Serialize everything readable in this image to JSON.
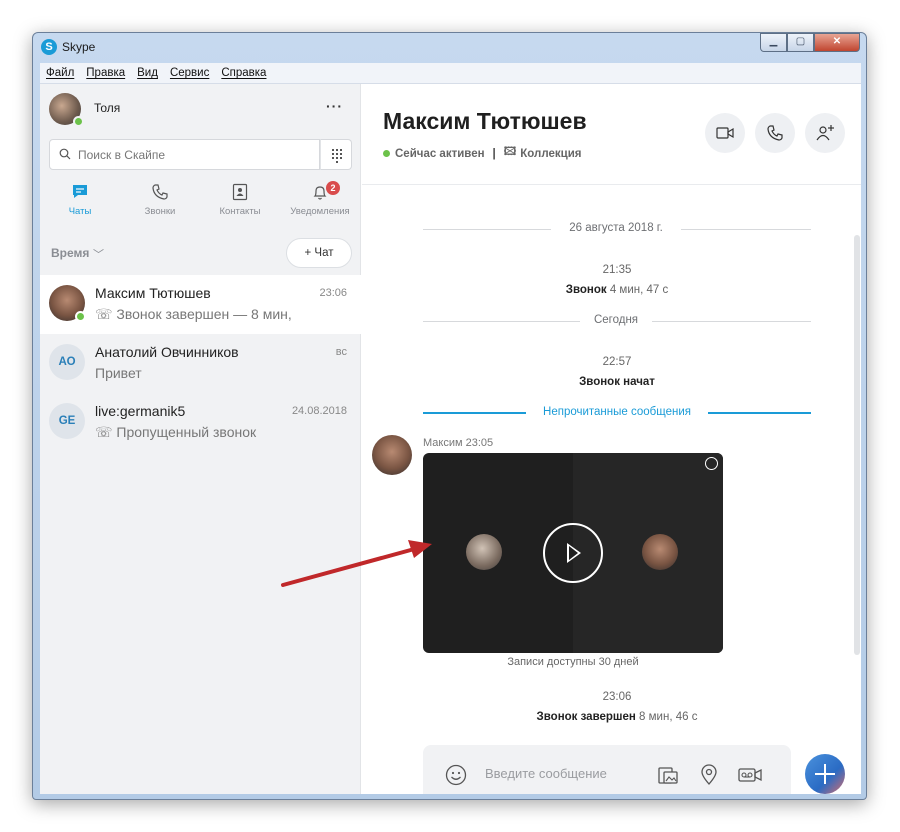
{
  "window": {
    "title": "Skype"
  },
  "menu": [
    "Файл",
    "Правка",
    "Вид",
    "Сервис",
    "Справка"
  ],
  "profile": {
    "name": "Толя"
  },
  "search": {
    "placeholder": "Поиск в Скайпе"
  },
  "nav": {
    "chats": "Чаты",
    "calls": "Звонки",
    "contacts": "Контакты",
    "notifications": "Уведомления",
    "notifications_badge": "2"
  },
  "sort": {
    "label": "Время",
    "new_chat": "+ Чат"
  },
  "chats": [
    {
      "name": "Максим Тютюшев",
      "time": "23:06",
      "preview": "Звонок завершен — 8 мин,",
      "preview_icon": "call-end-icon"
    },
    {
      "initials": "АО",
      "name": "Анатолий Овчинников",
      "time": "вс",
      "preview": "Привет"
    },
    {
      "initials": "GE",
      "name": "live:germanik5",
      "time": "24.08.2018",
      "preview": "Пропущенный звонок",
      "preview_icon": "missed-call-icon"
    }
  ],
  "conversation": {
    "contact_name": "Максим Тютюшев",
    "status": "Сейчас активен",
    "gallery": "Коллекция",
    "date1": "26 августа 2018 г.",
    "time1": "21:35",
    "call1_label": "Звонок",
    "call1_duration": "4 мин, 47 с",
    "date2": "Сегодня",
    "time2": "22:57",
    "call2_label": "Звонок начат",
    "unread": "Непрочитанные сообщения",
    "sender": "Максим 23:05",
    "recording_note": "Записи доступны 30 дней",
    "time3": "23:06",
    "call3_label": "Звонок завершен",
    "call3_duration": "8 мин, 46 с"
  },
  "composer": {
    "placeholder": "Введите сообщение"
  },
  "colors": {
    "accent": "#1a9bd7",
    "online": "#6cc24a",
    "badge": "#d94c4c",
    "arrow": "#c0282a"
  }
}
